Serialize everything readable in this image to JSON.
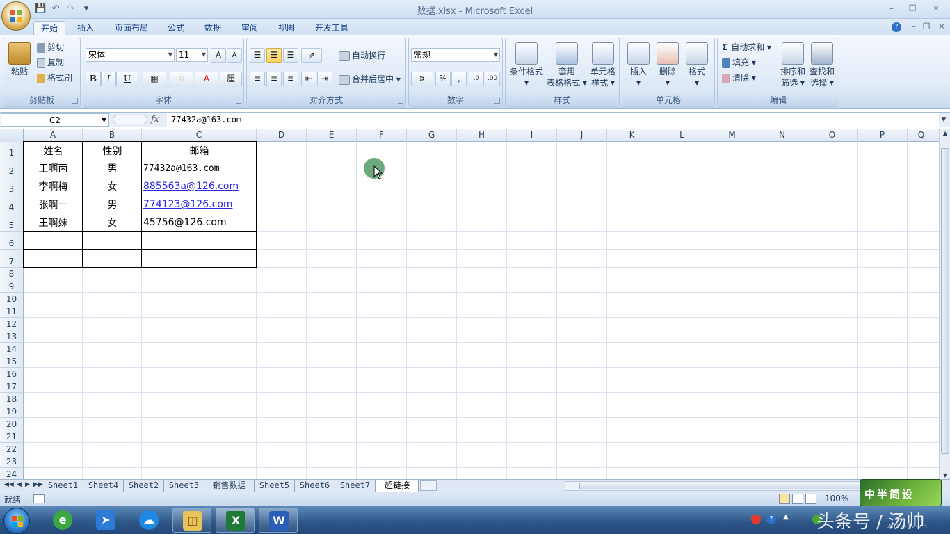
{
  "window": {
    "title": "数据.xlsx - Microsoft Excel"
  },
  "tabs": [
    "开始",
    "插入",
    "页面布局",
    "公式",
    "数据",
    "审阅",
    "视图",
    "开发工具"
  ],
  "ribbon": {
    "clipboard": {
      "paste": "粘贴",
      "cut": "剪切",
      "copy": "复制",
      "format_painter": "格式刷",
      "label": "剪贴板"
    },
    "font": {
      "name": "宋体",
      "size": "11",
      "label": "字体"
    },
    "alignment": {
      "wrap": "自动换行",
      "merge": "合并后居中",
      "label": "对齐方式"
    },
    "number": {
      "format": "常规",
      "label": "数字"
    },
    "styles": {
      "cond_format_1": "条件格式",
      "table_format_1": "套用",
      "table_format_2": "表格格式",
      "cell_style_1": "单元格",
      "cell_style_2": "样式",
      "label": "样式"
    },
    "cells": {
      "insert": "插入",
      "delete": "删除",
      "format": "格式",
      "label": "单元格"
    },
    "editing": {
      "autosum": "自动求和",
      "fill": "填充",
      "clear": "清除",
      "sort_1": "排序和",
      "sort_2": "筛选",
      "find_1": "查找和",
      "find_2": "选择",
      "label": "编辑"
    }
  },
  "formula_bar": {
    "name_box": "C2",
    "fx": "fx",
    "content": "77432a@163.com"
  },
  "columns": [
    "A",
    "B",
    "C",
    "D",
    "E",
    "F",
    "G",
    "H",
    "I",
    "J",
    "K",
    "L",
    "M",
    "N",
    "O",
    "P",
    "Q"
  ],
  "rows": [
    "1",
    "2",
    "3",
    "4",
    "5",
    "6",
    "7",
    "8",
    "9",
    "10",
    "11",
    "12",
    "13",
    "14",
    "15",
    "16",
    "17",
    "18",
    "19",
    "20",
    "21",
    "22",
    "23",
    "24"
  ],
  "table": {
    "headers": [
      "姓名",
      "性别",
      "邮箱"
    ],
    "rows": [
      [
        "王啊丙",
        "男",
        "77432a@163.com"
      ],
      [
        "李啊梅",
        "女",
        "885563a@126.com"
      ],
      [
        "张啊一",
        "男",
        "774123@126.com"
      ],
      [
        "王啊妹",
        "女",
        "45756@126.com"
      ]
    ]
  },
  "sheets": [
    "Sheet1",
    "Sheet4",
    "Sheet2",
    "Sheet3",
    "销售数据",
    "Sheet5",
    "Sheet6",
    "Sheet7",
    "超链接"
  ],
  "status": {
    "text": "就绪",
    "zoom": "100%"
  },
  "watermark": {
    "logo": "中半简设",
    "source": "头条号 / 汤帅",
    "date": "2017-12-23"
  },
  "colors": {
    "accent": "#15428b",
    "link": "#2a2aea",
    "ribbon": "#dbe7f5"
  }
}
